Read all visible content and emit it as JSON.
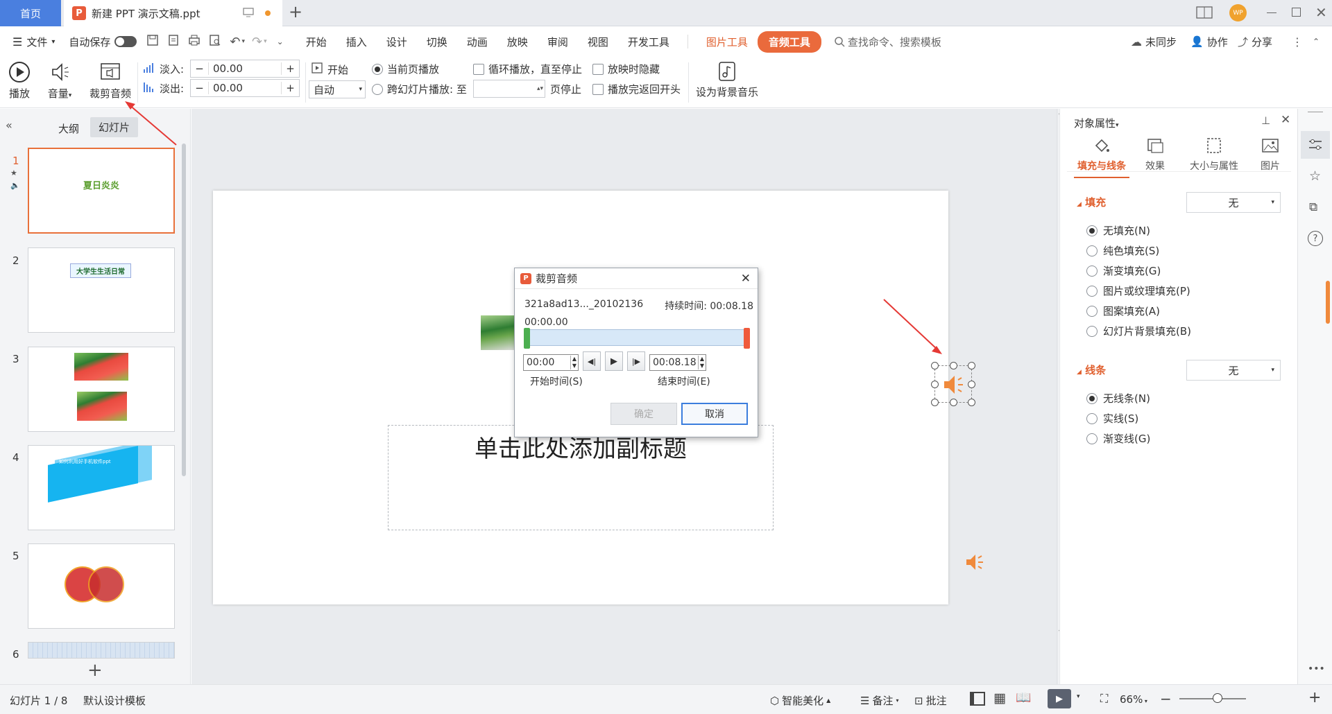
{
  "titlebar": {
    "home_tab": "首页",
    "doc_tab": "新建 PPT 演示文稿.ppt",
    "new_tab": "+",
    "avatar": "WP"
  },
  "menu": {
    "file": "文件",
    "autosave": "自动保存",
    "tabs": [
      "开始",
      "插入",
      "设计",
      "切换",
      "动画",
      "放映",
      "审阅",
      "视图",
      "开发工具"
    ],
    "picture_tools": "图片工具",
    "audio_tools": "音频工具",
    "search_placeholder": "查找命令、搜索模板",
    "unsynced": "未同步",
    "collaborate": "协作",
    "share": "分享"
  },
  "ribbon": {
    "play": "播放",
    "volume": "音量",
    "trim_audio": "裁剪音频",
    "fade_in_label": "淡入:",
    "fade_in_value": "00.00",
    "fade_out_label": "淡出:",
    "fade_out_value": "00.00",
    "start_label": "开始",
    "start_select": "自动",
    "current_page_play": "当前页播放",
    "cross_slide_play": "跨幻灯片播放: 至",
    "page_stop": "页停止",
    "loop_play": "循环播放，直至停止",
    "hide_when_play": "放映时隐藏",
    "rewind_after": "播放完返回开头",
    "set_bg_music": "设为背景音乐"
  },
  "leftpanel": {
    "tab_outline": "大纲",
    "tab_slides": "幻灯片",
    "slide_nums": [
      "1",
      "2",
      "3",
      "4",
      "5",
      "6"
    ],
    "slide1_title": "夏日炎炎",
    "slide2_title": "大学生生活日常",
    "slide4_title": "如何利用好手机软件ppt"
  },
  "slide": {
    "subtitle_placeholder": "单击此处添加副标题"
  },
  "dialog": {
    "title": "裁剪音频",
    "filename": "321a8ad13..._20102136",
    "duration_label": "持续时间:",
    "duration_value": "00:08.18",
    "position": "00:00.00",
    "start_time_value": "00:00",
    "end_time_value": "00:08.18",
    "start_time_label": "开始时间(S)",
    "end_time_label": "结束时间(E)",
    "ok": "确定",
    "cancel": "取消"
  },
  "rightpanel": {
    "header": "对象属性",
    "tabs": [
      "填充与线条",
      "效果",
      "大小与属性",
      "图片"
    ],
    "fill_section": "填充",
    "fill_dropdown": "无",
    "fill_options": [
      "无填充(N)",
      "纯色填充(S)",
      "渐变填充(G)",
      "图片或纹理填充(P)",
      "图案填充(A)",
      "幻灯片背景填充(B)"
    ],
    "line_section": "线条",
    "line_dropdown": "无",
    "line_options": [
      "无线条(N)",
      "实线(S)",
      "渐变线(G)"
    ]
  },
  "statusbar": {
    "slide_count": "幻灯片 1 / 8",
    "template": "默认设计模板",
    "smart_beautify": "智能美化",
    "notes": "备注",
    "comments": "批注",
    "zoom": "66%"
  },
  "colors": {
    "accent": "#ea6a3c",
    "home_tab": "#4a7fdf",
    "dialog_primary": "#3b7ddd"
  }
}
